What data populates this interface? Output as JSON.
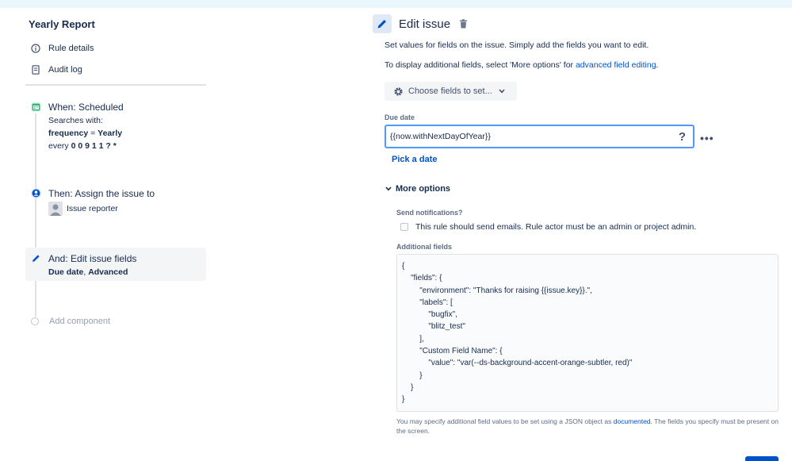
{
  "left": {
    "rule_title": "Yearly Report",
    "nav": [
      {
        "label": "Rule details",
        "icon": "info-icon"
      },
      {
        "label": "Audit log",
        "icon": "audit-log-icon"
      }
    ],
    "components": {
      "trigger": {
        "title": "When: Scheduled",
        "line1": "Searches with:",
        "line2_key": "frequency",
        "line2_eq": " = ",
        "line2_val": "Yearly",
        "line3_prefix": "every ",
        "line3_val": "0 0 9 1 1 ? *",
        "icon": "calendar-icon",
        "icon_color": "#36b37e"
      },
      "action1": {
        "title": "Then: Assign the issue to",
        "assignee": "Issue reporter",
        "icon": "user-circle-icon",
        "icon_color": "#0052cc"
      },
      "action2": {
        "title": "And: Edit issue fields",
        "detail_bold1": "Due date",
        "detail_sep": ", ",
        "detail_bold2": "Advanced",
        "icon": "pencil-icon",
        "icon_color": "#0052cc"
      },
      "add": {
        "label": "Add component"
      }
    }
  },
  "right": {
    "title": "Edit issue",
    "desc1": "Set values for fields on the issue. Simply add the fields you want to edit.",
    "desc2_prefix": "To display additional fields, select 'More options' for ",
    "desc2_link": "advanced field editing",
    "desc2_suffix": ".",
    "choose_button": "Choose fields to set...",
    "due_date_label": "Due date",
    "due_date_value": "{{now.withNextDayOfYear}}",
    "help_q": "?",
    "more_dots": "•••",
    "pick_date": "Pick a date",
    "more_options": "More options",
    "send_notifications_label": "Send notifications?",
    "send_notifications_text": "This rule should send emails. Rule actor must be an admin or project admin.",
    "additional_fields_label": "Additional fields",
    "code_lines": [
      "{",
      "    \"fields\": {",
      "        \"environment\": \"Thanks for raising {{issue.key}}.\",",
      "        \"labels\": [",
      "            \"bugfix\",",
      "            \"blitz_test\"",
      "        ],",
      "        \"Custom Field Name\": {",
      "            \"value\": \"var(--ds-background-accent-orange-subtler, red)\"",
      "        }",
      "    }",
      "}"
    ],
    "help_prefix": "You may specify additional field values to be set using a JSON object as ",
    "help_link": "documented",
    "help_suffix": ". The fields you specify must be present on the screen."
  },
  "colors": {
    "accent": "#0052cc",
    "focus_border": "#4c9aff",
    "top_bar": "#e9f6fb"
  }
}
